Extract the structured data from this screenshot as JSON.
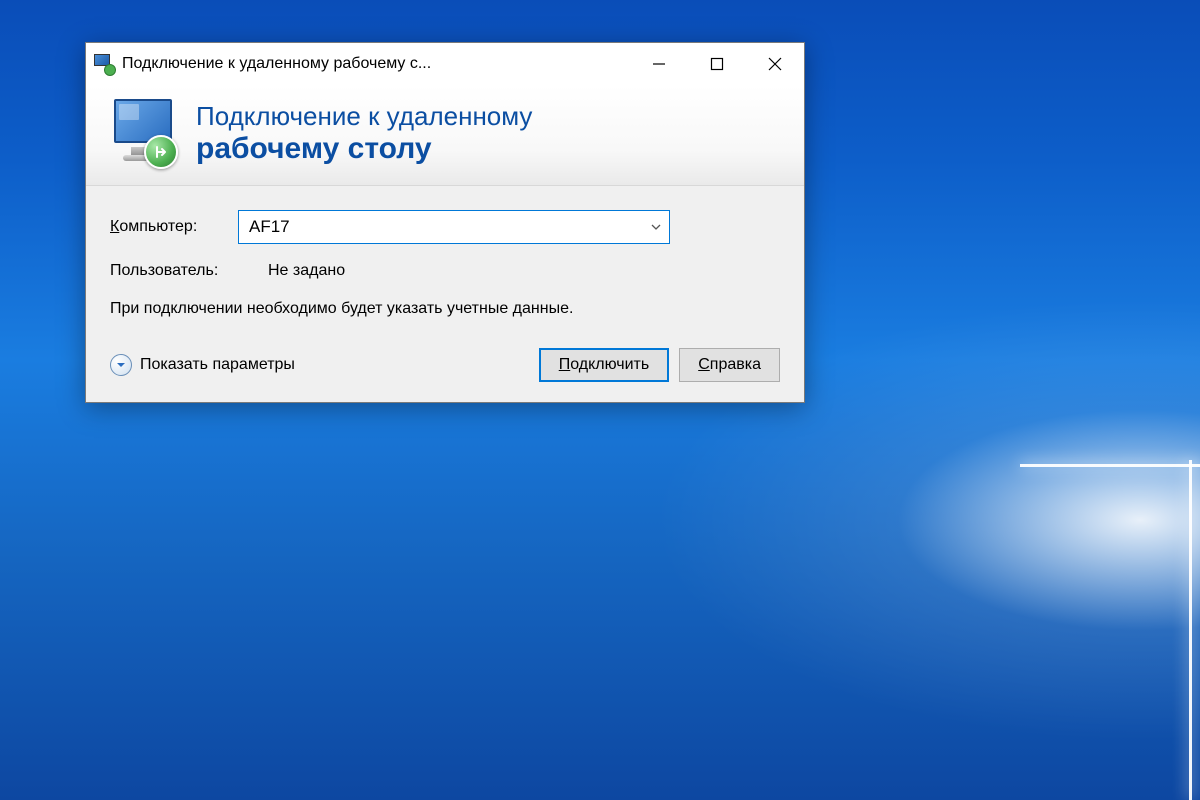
{
  "window": {
    "title": "Подключение к удаленному рабочему с..."
  },
  "banner": {
    "line1": "Подключение к удаленному",
    "line2": "рабочему столу"
  },
  "form": {
    "computer_label_prefix": "К",
    "computer_label_rest": "омпьютер:",
    "computer_value": "AF17",
    "user_label": "Пользователь:",
    "user_value": "Не задано",
    "info_text": "При подключении необходимо будет указать учетные данные."
  },
  "footer": {
    "expand_prefix": "П",
    "expand_rest": "оказать параметры",
    "connect_prefix": "П",
    "connect_rest": "одключить",
    "help_prefix": "С",
    "help_rest": "правка"
  }
}
